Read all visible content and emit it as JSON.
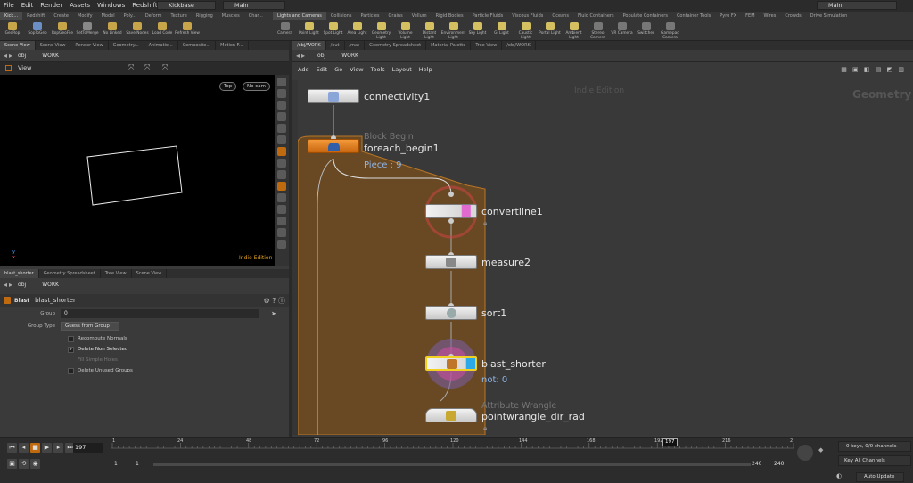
{
  "menu": [
    "File",
    "Edit",
    "Render",
    "Assets",
    "Windows",
    "Redshift",
    "Help"
  ],
  "desktop": "Kickbase",
  "main_selector": "Main",
  "main_selector_right": "Main",
  "shelf_left_tabs": [
    "Kick...",
    "Redshift",
    "Create",
    "Modify",
    "Model",
    "Poly...",
    "Deform",
    "Texture",
    "Rigging",
    "Muscles",
    "Char..."
  ],
  "shelf_left_tools": [
    "GeoRop",
    "SopToGeo",
    "RopGeoFile",
    "SetToMerge",
    "No Linked",
    "Save Nodes",
    "Load Code",
    "Refresh View"
  ],
  "shelf_right_tabs": [
    "Lights and Cameras",
    "Collisions",
    "Particles",
    "Grains",
    "Vellum",
    "Rigid Bodies",
    "Particle Fluids",
    "Viscous Fluids",
    "Oceans",
    "Fluid Containers",
    "Populate Containers",
    "Container Tools",
    "Pyro FX",
    "FEM",
    "Wires",
    "Crowds",
    "Drive Simulation"
  ],
  "shelf_right_tools": [
    "Camera",
    "Point Light",
    "Spot Light",
    "Area Light",
    "Geometry Light",
    "Volume Light",
    "Distant Light",
    "Environment Light",
    "Sky Light",
    "GI Light",
    "Caustic Light",
    "Portal Light",
    "Ambient Light",
    "Stereo Camera",
    "VR Camera",
    "Switcher",
    "Gamepad Camera"
  ],
  "left_top_tabs": [
    "Scene View",
    "Scene View",
    "Render View",
    "Geometry...",
    "Animatio...",
    "Composite...",
    "Motion F..."
  ],
  "left_path": {
    "context": "obj",
    "node": "WORK"
  },
  "viewport": {
    "title": "View",
    "persp": "Top",
    "cam": "No cam",
    "edition": "Indie Edition"
  },
  "params_tabs": [
    "blast_shorter",
    "Geometry Spreadsheet",
    "Tree View",
    "Scene View"
  ],
  "params_path": {
    "context": "obj",
    "node": "WORK"
  },
  "params": {
    "type_label": "Blast",
    "node_name": "blast_shorter",
    "group_label": "Group",
    "group_value": "0",
    "group_type_label": "Group Type",
    "group_type_value": "Guess from Group",
    "opt1": "Recompute Normals",
    "opt2": "Delete Non Selected",
    "opt3": "Fill Simple Holes",
    "opt4": "Delete Unused Groups"
  },
  "net_tabs": [
    "/obj/WORK",
    "/out",
    "/mat",
    "Geometry Spreadsheet",
    "Material Palette",
    "Tree View",
    "/obj/WORK"
  ],
  "net_path": {
    "context": "obj",
    "node": "WORK"
  },
  "net_menu": [
    "Add",
    "Edit",
    "Go",
    "View",
    "Tools",
    "Layout",
    "Help"
  ],
  "net_watermark": "Indie Edition",
  "net_context": "Geometry",
  "nodes": {
    "connectivity": "connectivity1",
    "foreach_sub": "Block Begin",
    "foreach": "foreach_begin1",
    "piece": "Piece : 9",
    "convertline": "convertline1",
    "measure": "measure2",
    "sort": "sort1",
    "blast": "blast_shorter",
    "not": "not: 0",
    "wrangle_sub": "Attribute Wrangle",
    "wrangle": "pointwrangle_dir_rad"
  },
  "timeline": {
    "frame": "197",
    "ticks": [
      "1",
      "24",
      "48",
      "72",
      "96",
      "120",
      "144",
      "168",
      "192",
      "216",
      "2"
    ],
    "current_marker": "197",
    "range_start": "1",
    "range_start2": "1",
    "range_end": "240",
    "range_end2": "240",
    "keys": "0 keys, 0/0 channels",
    "key_channels": "Key All Channels",
    "auto_update": "Auto Update"
  }
}
